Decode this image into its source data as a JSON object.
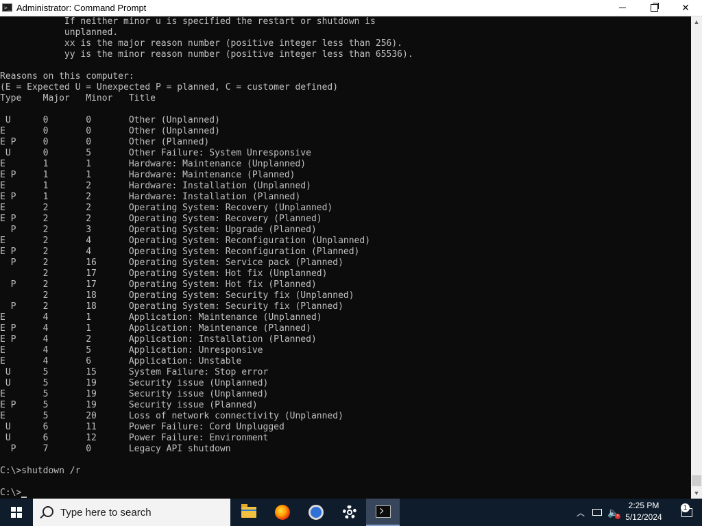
{
  "window": {
    "title": "Administrator: Command Prompt",
    "icon": "cmd-icon",
    "controls": [
      "minimize",
      "maximize",
      "close"
    ]
  },
  "console": {
    "lines": [
      "            If neither minor u is specified the restart or shutdown is",
      "            unplanned.",
      "            xx is the major reason number (positive integer less than 256).",
      "            yy is the minor reason number (positive integer less than 65536).",
      "",
      "Reasons on this computer:",
      "(E = Expected U = Unexpected P = planned, C = customer defined)",
      "Type    Major   Minor   Title",
      "",
      " U      0       0       Other (Unplanned)",
      "E       0       0       Other (Unplanned)",
      "E P     0       0       Other (Planned)",
      " U      0       5       Other Failure: System Unresponsive",
      "E       1       1       Hardware: Maintenance (Unplanned)",
      "E P     1       1       Hardware: Maintenance (Planned)",
      "E       1       2       Hardware: Installation (Unplanned)",
      "E P     1       2       Hardware: Installation (Planned)",
      "E       2       2       Operating System: Recovery (Unplanned)",
      "E P     2       2       Operating System: Recovery (Planned)",
      "  P     2       3       Operating System: Upgrade (Planned)",
      "E       2       4       Operating System: Reconfiguration (Unplanned)",
      "E P     2       4       Operating System: Reconfiguration (Planned)",
      "  P     2       16      Operating System: Service pack (Planned)",
      "        2       17      Operating System: Hot fix (Unplanned)",
      "  P     2       17      Operating System: Hot fix (Planned)",
      "        2       18      Operating System: Security fix (Unplanned)",
      "  P     2       18      Operating System: Security fix (Planned)",
      "E       4       1       Application: Maintenance (Unplanned)",
      "E P     4       1       Application: Maintenance (Planned)",
      "E P     4       2       Application: Installation (Planned)",
      "E       4       5       Application: Unresponsive",
      "E       4       6       Application: Unstable",
      " U      5       15      System Failure: Stop error",
      " U      5       19      Security issue (Unplanned)",
      "E       5       19      Security issue (Unplanned)",
      "E P     5       19      Security issue (Planned)",
      "E       5       20      Loss of network connectivity (Unplanned)",
      " U      6       11      Power Failure: Cord Unplugged",
      " U      6       12      Power Failure: Environment",
      "  P     7       0       Legacy API shutdown",
      "",
      "C:\\>shutdown /r",
      "",
      "C:\\>"
    ]
  },
  "taskbar": {
    "search_placeholder": "Type here to search",
    "apps": [
      {
        "name": "file-explorer-icon",
        "active": false
      },
      {
        "name": "firefox-icon",
        "active": false
      },
      {
        "name": "chromium-icon",
        "active": false
      },
      {
        "name": "settings-gear-icon",
        "active": false
      },
      {
        "name": "command-prompt-icon",
        "active": true
      }
    ],
    "clock": {
      "time": "2:25 PM",
      "date": "5/12/2024"
    },
    "notification_count": "1",
    "tray_icons": [
      "chevron-up-icon",
      "network-icon",
      "volume-muted-icon"
    ]
  }
}
